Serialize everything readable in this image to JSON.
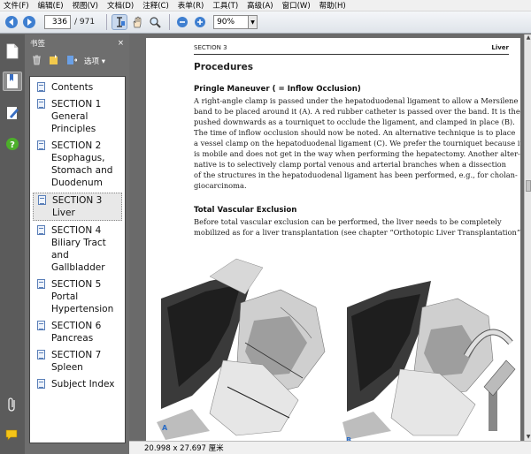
{
  "menu": [
    "文件(F)",
    "编辑(E)",
    "视图(V)",
    "文档(D)",
    "注释(C)",
    "表单(R)",
    "工具(T)",
    "高级(A)",
    "窗口(W)",
    "帮助(H)"
  ],
  "toolbar": {
    "current_page": "336",
    "total_pages": "/ 971",
    "zoom": "90%"
  },
  "bookmarks": {
    "title": "书签",
    "close": "×",
    "options": "选项",
    "items": [
      {
        "label": "Contents"
      },
      {
        "label": "SECTION 1 General Principles"
      },
      {
        "label": "SECTION 2 Esophagus, Stomach and Duodenum"
      },
      {
        "label": "SECTION 3 Liver"
      },
      {
        "label": "SECTION 4 Biliary Tract and Gallbladder"
      },
      {
        "label": "SECTION 5 Portal Hypertension"
      },
      {
        "label": "SECTION 6 Pancreas"
      },
      {
        "label": "SECTION 7 Spleen"
      },
      {
        "label": "Subject Index"
      }
    ],
    "selected_index": 3
  },
  "page": {
    "header_left": "SECTION 3",
    "header_right": "Liver",
    "heading": "Procedures",
    "pringle": {
      "title": "Pringle Maneuver ( = Inflow Occlusion)",
      "lines": [
        "A right-angle clamp is passed under the hepatoduodenal ligament to allow a Mersilene",
        "band to be placed around it (A). A red rubber catheter is passed over the band. It is then",
        "pushed downwards as a tourniquet to occlude the ligament, and clamped in place (B).",
        "The time of inflow occlusion should now be noted. An alternative technique is to place",
        "a vessel clamp on the hepatoduodenal ligament (C). We prefer the tourniquet because it",
        "is mobile and does not get in the way when performing the hepatectomy. Another alter-",
        "native is to selectively clamp portal venous and arterial branches when a dissection",
        "of the structures in the hepatoduodenal ligament has been performed, e.g., for cholan-",
        "giocarcinoma."
      ]
    },
    "tve": {
      "title": "Total Vascular Exclusion",
      "lines": [
        "Before total vascular exclusion can be performed, the liver needs to be completely",
        "mobilized as for a liver transplantation (see chapter “Orthotopic Liver Transplantation”)."
      ]
    },
    "figure_labels": [
      "A",
      "B"
    ]
  },
  "status": {
    "page_size": "20.998 x 27.697 厘米"
  },
  "colors": {
    "accent_blue": "#2b6cc4",
    "panel_gray": "#6e6e6e"
  }
}
